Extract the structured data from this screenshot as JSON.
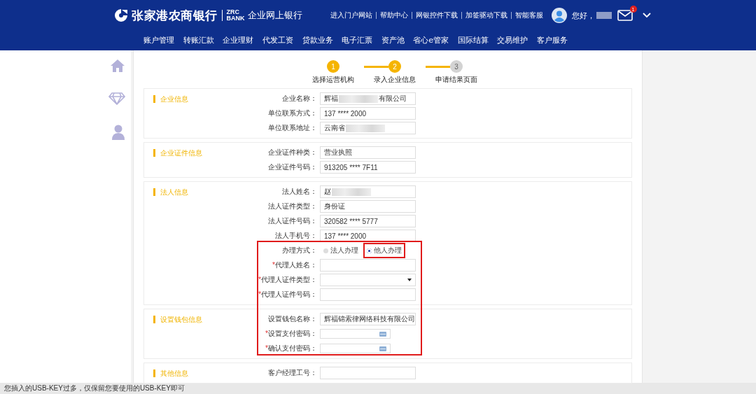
{
  "header": {
    "bank_name": "张家港农商银行",
    "bank_code_top": "ZRC",
    "bank_code_bottom": "BANK",
    "product": "企业网上银行",
    "links": [
      "进入门户网站",
      "帮助中心",
      "网银控件下载",
      "加签驱动下载",
      "智能客服"
    ],
    "greeting": "您好，",
    "user_redacted": true,
    "mail_badge": "1"
  },
  "nav": [
    "账户管理",
    "转账汇款",
    "企业理财",
    "代发工资",
    "贷款业务",
    "电子汇票",
    "资产池",
    "省心e管家",
    "国际结算",
    "交易维护",
    "客户服务"
  ],
  "steps": [
    {
      "number": "1",
      "label": "选择运营机构",
      "reached": true
    },
    {
      "number": "2",
      "label": "录入企业信息",
      "reached": true
    },
    {
      "number": "3",
      "label": "申请结果页面",
      "reached": false
    }
  ],
  "sections": [
    {
      "title": "企业信息",
      "fields": [
        {
          "kind": "text",
          "label": "企业名称：",
          "value": "辉福",
          "redacted": true,
          "value_after": "有限公司"
        },
        {
          "kind": "text",
          "label": "单位联系方式：",
          "value": "137 **** 2000"
        },
        {
          "kind": "text",
          "label": "单位联系地址：",
          "value": "云南省",
          "redacted": true
        }
      ]
    },
    {
      "title": "企业证件信息",
      "fields": [
        {
          "kind": "text",
          "label": "企业证件种类：",
          "value": "营业执照"
        },
        {
          "kind": "text",
          "label": "企业证件号码：",
          "value": "913205 **** 7F11"
        }
      ]
    },
    {
      "title": "法人信息",
      "fields": [
        {
          "kind": "text",
          "label": "法人姓名：",
          "value": "赵",
          "redacted": true
        },
        {
          "kind": "text",
          "label": "法人证件类型：",
          "value": "身份证"
        },
        {
          "kind": "text",
          "label": "法人证件号码：",
          "value": "320582 **** 5777"
        },
        {
          "kind": "text",
          "label": "法人手机号：",
          "value": "137 **** 2000"
        },
        {
          "kind": "radio",
          "label": "办理方式：",
          "options": [
            {
              "label": "法人办理",
              "selected": false
            },
            {
              "label": "他人办理",
              "selected": true
            }
          ]
        },
        {
          "kind": "text",
          "label": "代理人姓名：",
          "required_mark": "*"
        },
        {
          "kind": "select",
          "label": "代理人证件类型：",
          "required_mark": "*"
        },
        {
          "kind": "text",
          "label": "代理人证件号码：",
          "required_mark": "*"
        }
      ]
    },
    {
      "title": "设置钱包信息",
      "fields": [
        {
          "kind": "text",
          "label": "设置钱包名称：",
          "value": "辉福锦索律网络科技有限公司"
        },
        {
          "kind": "password",
          "label": "设置支付密码：",
          "required_mark": "*"
        },
        {
          "kind": "password",
          "label": "确认支付密码：",
          "required_mark": "*"
        }
      ]
    },
    {
      "title": "其他信息",
      "fields": [
        {
          "kind": "text",
          "label": "客户经理工号："
        }
      ]
    }
  ],
  "status_bar": "您插入的USB-KEY过多，仅保留您要使用的USB-KEY即可"
}
